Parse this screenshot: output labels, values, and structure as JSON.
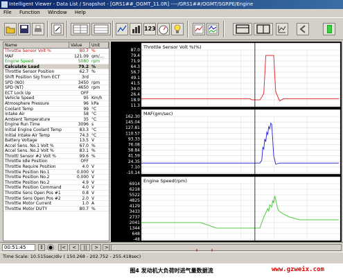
{
  "window": {
    "title": "Intelligent Viewer - Data List / Snapshot - [GRS1##_OGMT_11.0R] ----/GRS1##/OGMT/SGRPE/Engine",
    "menus": [
      "File",
      "Function",
      "Window",
      "Help"
    ]
  },
  "toolbar": {
    "buttons": [
      "open-folder",
      "save",
      "print",
      "edit",
      "table-view",
      "table-view-2",
      "graph",
      "bar-chart",
      "123",
      "gauge",
      "bulb",
      "bar-graph",
      "multi-graph",
      "split-view",
      "columns",
      "graph-settings",
      "back",
      "exit"
    ]
  },
  "list": {
    "headers": [
      "Name",
      "Value",
      "Unit"
    ],
    "rows": [
      {
        "name": "Throttle Sensor Volt %",
        "value": "80.7",
        "unit": "%",
        "style": "red"
      },
      {
        "name": "MAF",
        "value": "121.09",
        "unit": "gm/...",
        "style": "normal"
      },
      {
        "name": "Engine Speed",
        "value": "5080",
        "unit": "rpm",
        "style": "green"
      },
      {
        "name": "Calculate Load",
        "value": "79.2",
        "unit": "%",
        "style": "sel"
      },
      {
        "name": "Throttle Sensor Position",
        "value": "62.7",
        "unit": "%",
        "style": "normal"
      },
      {
        "name": "Shift Position Sig from ECT",
        "value": "3rd",
        "unit": "",
        "style": "normal"
      },
      {
        "name": "SPD (NO)",
        "value": "3450",
        "unit": "rpm",
        "style": "normal"
      },
      {
        "name": "SPD (NT)",
        "value": "4650",
        "unit": "rpm",
        "style": "normal"
      },
      {
        "name": "ECT Lock Up",
        "value": "OFF",
        "unit": "",
        "style": "normal"
      },
      {
        "name": "Vehicle Speed",
        "value": "95",
        "unit": "Km/h",
        "style": "normal"
      },
      {
        "name": "Atmosphere Pressure",
        "value": "96",
        "unit": "kPa",
        "style": "normal"
      },
      {
        "name": "Coolant Temp",
        "value": "99",
        "unit": "°C",
        "style": "normal"
      },
      {
        "name": "Intake Air",
        "value": "58",
        "unit": "°C",
        "style": "normal"
      },
      {
        "name": "Ambient Temperature",
        "value": "35",
        "unit": "°C",
        "style": "normal"
      },
      {
        "name": "Engine Run Time",
        "value": "3096",
        "unit": "s",
        "style": "normal"
      },
      {
        "name": "Initial Engine Coolant Temp",
        "value": "83.3",
        "unit": "°C",
        "style": "normal"
      },
      {
        "name": "Initial Intake Air Temp",
        "value": "74.3",
        "unit": "°C",
        "style": "normal"
      },
      {
        "name": "Battery Voltage",
        "value": "13.5",
        "unit": "V",
        "style": "normal"
      },
      {
        "name": "Accel Sens. No.1 Volt %",
        "value": "67.0",
        "unit": "%",
        "style": "normal"
      },
      {
        "name": "Accel Sens. No.2 Volt %",
        "value": "83.1",
        "unit": "%",
        "style": "normal"
      },
      {
        "name": "Throttl Sensor #2 Volt %",
        "value": "99.6",
        "unit": "%",
        "style": "normal"
      },
      {
        "name": "Throttle Idle Position",
        "value": "OFF",
        "unit": "",
        "style": "normal"
      },
      {
        "name": "Throttle Require Position",
        "value": "4.0",
        "unit": "V",
        "style": "normal"
      },
      {
        "name": "Throttle Position No.1",
        "value": "0.000",
        "unit": "V",
        "style": "normal"
      },
      {
        "name": "Throttle Position No.2",
        "value": "0.000",
        "unit": "V",
        "style": "normal"
      },
      {
        "name": "Throttle Position No.2",
        "value": "4.9",
        "unit": "V",
        "style": "normal"
      },
      {
        "name": "Throttle Position Command",
        "value": "4.0",
        "unit": "V",
        "style": "normal"
      },
      {
        "name": "Throttle Sens Open Pos #1",
        "value": "0.8",
        "unit": "V",
        "style": "normal"
      },
      {
        "name": "Throttle Sens Open Pos #2",
        "value": "2.0",
        "unit": "V",
        "style": "normal"
      },
      {
        "name": "Throttle Motor Current",
        "value": "1.0",
        "unit": "A",
        "style": "normal"
      },
      {
        "name": "Throttle Motor DUTY",
        "value": "80.7",
        "unit": "%",
        "style": "normal"
      }
    ]
  },
  "graphs": [
    {
      "label": "Throttle Sensor Volt %(%)",
      "color": "#e03030",
      "ticks": [
        "87.0",
        "79.4",
        "71.9",
        "64.3",
        "56.7",
        "49.1",
        "41.5",
        "34.0",
        "26.4",
        "18.9",
        "11.3"
      ]
    },
    {
      "label": "MAF(gm/sec)",
      "color": "#3030d0",
      "ticks": [
        "162.30",
        "145.04",
        "127.81",
        "110.57",
        "93.33",
        "76.08",
        "58.84",
        "41.59",
        "24.35",
        "7.10",
        "-10.14"
      ]
    },
    {
      "label": "Engine Speed(rpm)",
      "color": "#50c840",
      "ticks": [
        "6914",
        "6218",
        "5522",
        "4825",
        "4129",
        "3433",
        "2737",
        "2041",
        "1344",
        "648",
        "-48"
      ]
    }
  ],
  "player": {
    "time": "00:51:45",
    "buttons": [
      "|<",
      "<",
      "||",
      ">",
      ">|"
    ]
  },
  "status": {
    "time_scale": "Time Scale: 10.515sec/div ( 150.268 - 202.752 - 255.418sec)"
  },
  "caption": "图4 发动机大负荷时进气量数据流",
  "watermark": "www.gzweix.com"
}
